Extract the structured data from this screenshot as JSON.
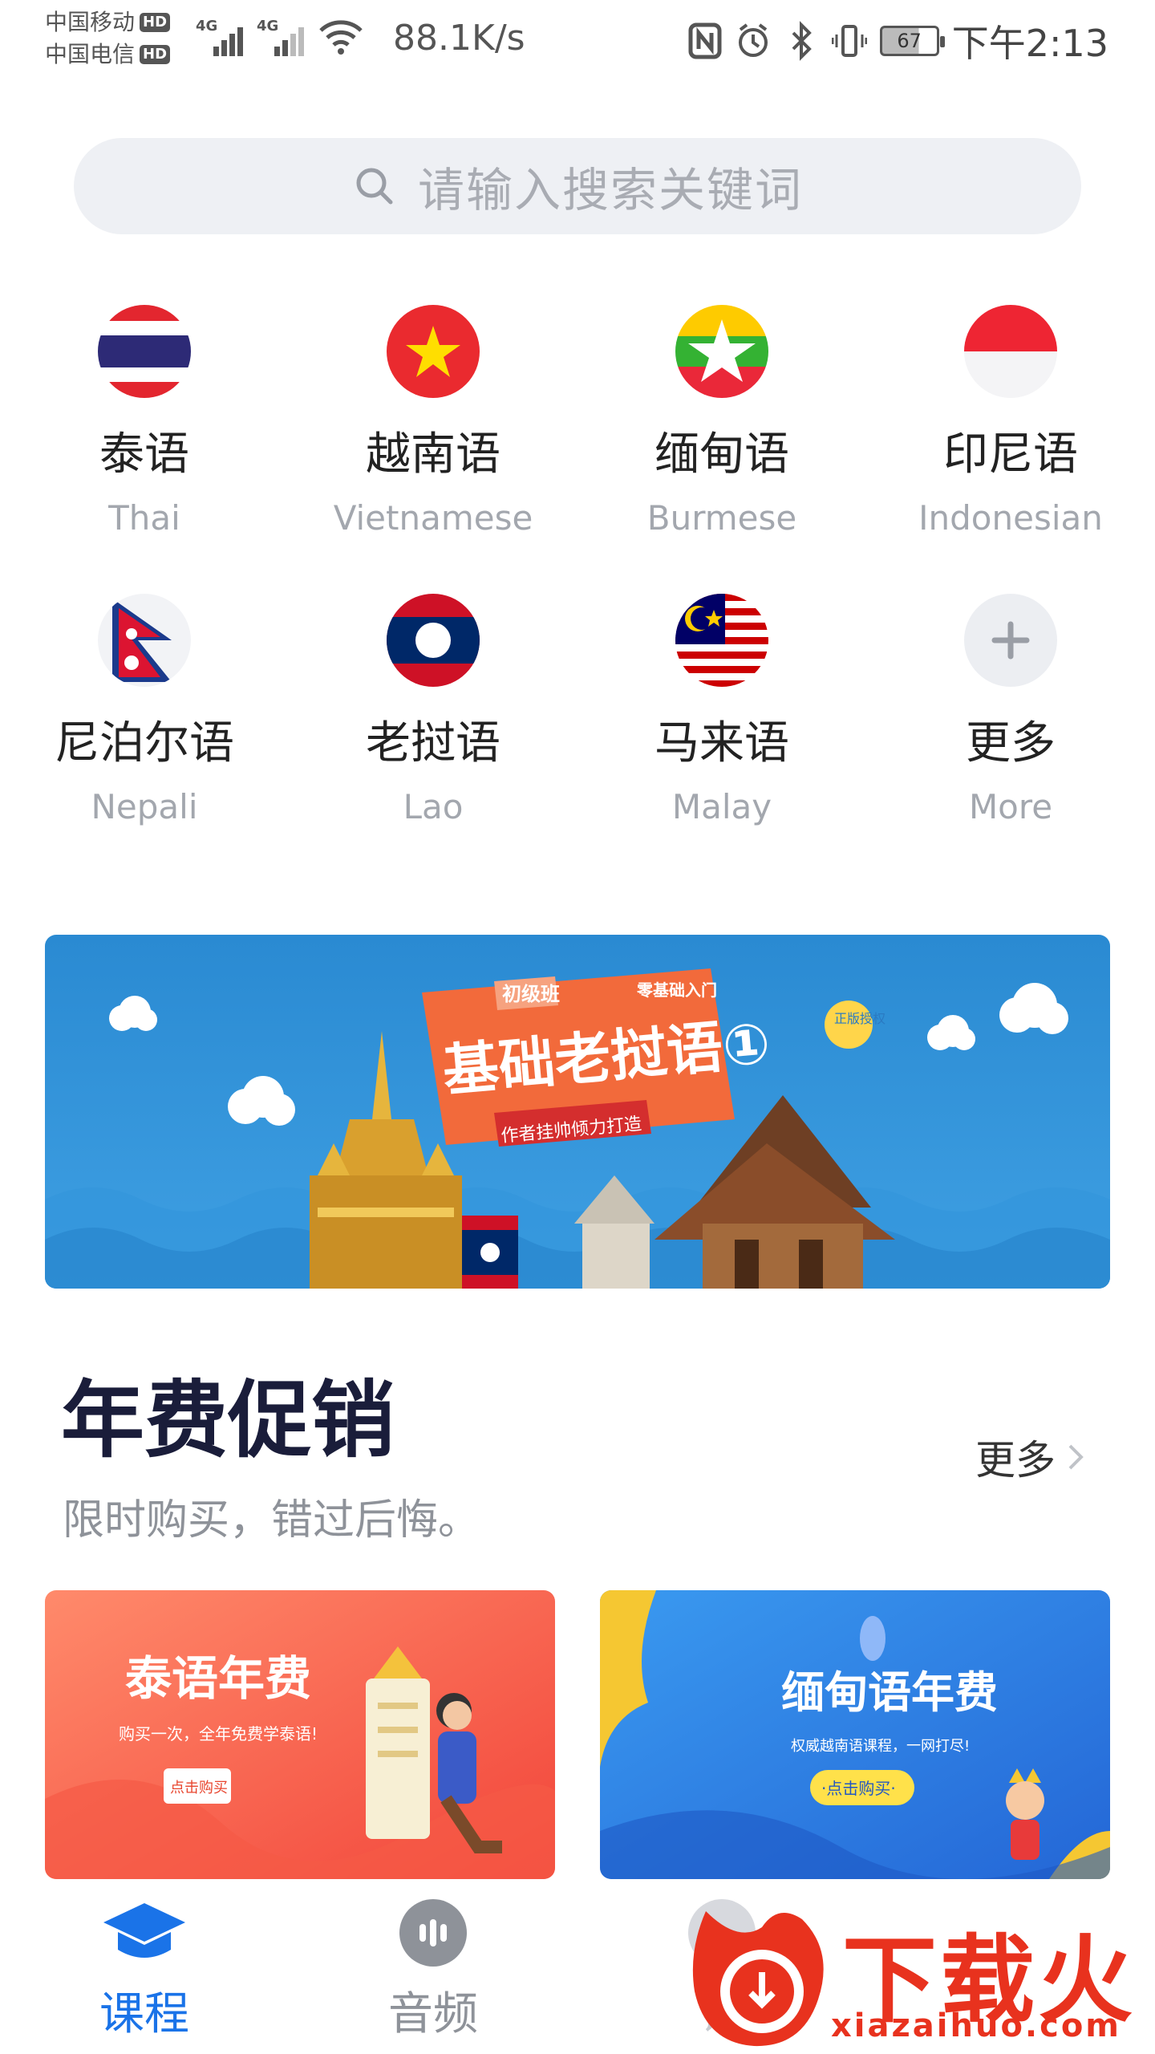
{
  "status_bar": {
    "carrier_1": "中国移动",
    "carrier_2": "中国电信",
    "hd_label": "HD",
    "signal_label": "4G",
    "speed": "88.1K/s",
    "battery": "67",
    "time": "下午2:13",
    "icons": [
      "nfc-icon",
      "alarm-icon",
      "bluetooth-icon",
      "vibrate-icon",
      "battery-icon"
    ]
  },
  "search": {
    "placeholder": "请输入搜索关键词",
    "icon": "search-icon"
  },
  "languages": [
    {
      "cn": "泰语",
      "en": "Thai",
      "icon": "thai-flag-icon"
    },
    {
      "cn": "越南语",
      "en": "Vietnamese",
      "icon": "vietnam-flag-icon"
    },
    {
      "cn": "缅甸语",
      "en": "Burmese",
      "icon": "myanmar-flag-icon"
    },
    {
      "cn": "印尼语",
      "en": "Indonesian",
      "icon": "indonesia-flag-icon"
    },
    {
      "cn": "尼泊尔语",
      "en": "Nepali",
      "icon": "nepal-flag-icon"
    },
    {
      "cn": "老挝语",
      "en": "Lao",
      "icon": "laos-flag-icon"
    },
    {
      "cn": "马来语",
      "en": "Malay",
      "icon": "malaysia-flag-icon"
    },
    {
      "cn": "更多",
      "en": "More",
      "icon": "plus-icon"
    }
  ],
  "banner": {
    "badge": "初级班",
    "tagline": "零基础入门",
    "title": "基础老挝语①",
    "subtitle": "作者挂帅倾力打造",
    "stamp": "正版授权"
  },
  "section": {
    "title": "年费促销",
    "subtitle": "限时购买，错过后悔。",
    "more": "更多"
  },
  "promos": [
    {
      "title": "泰语年费",
      "desc": "购买一次，全年免费学泰语!",
      "button": "点击购买"
    },
    {
      "title": "缅甸语年费",
      "desc": "权威越南语课程，一网打尽!",
      "button": "·点击购买·"
    }
  ],
  "tabs": [
    {
      "label": "课程",
      "icon": "graduation-cap-icon",
      "active": true
    },
    {
      "label": "音频",
      "icon": "audio-icon",
      "active": false
    },
    {
      "label": "词",
      "icon": "dictionary-icon",
      "active": false
    }
  ],
  "watermark": {
    "text": "下载火",
    "url": "xiazaihuo.com"
  },
  "colors": {
    "accent": "#1a73e8",
    "inactive_tab": "#8e9299",
    "title": "#1a1d3a",
    "banner_bg": "#2f8fd6",
    "promo_left": "#ff6b4f",
    "promo_right": "#2f86e8",
    "watermark": "#e8321e"
  }
}
